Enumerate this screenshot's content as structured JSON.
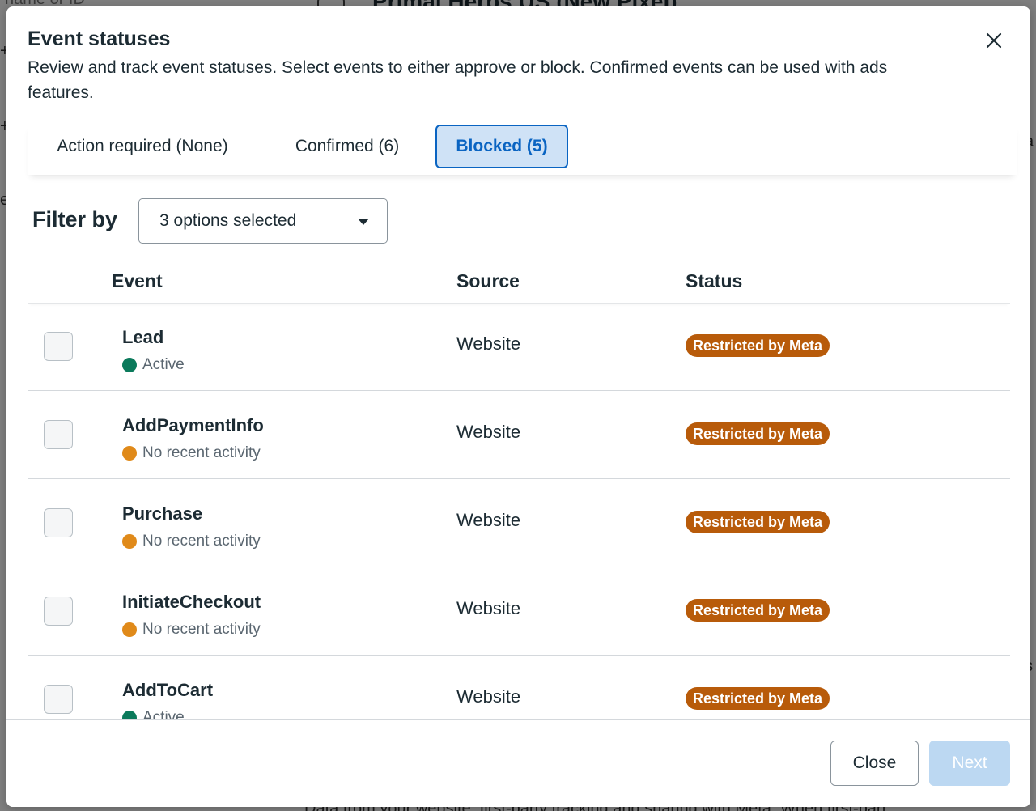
{
  "background": {
    "search_fragment": "name or ID",
    "page_title_fragment": "Primal Herbs US (New Pixel)",
    "bottom_text_fragment": "Data from your website, first-party tracking and sharing with Meta. When first-part"
  },
  "modal": {
    "title": "Event statuses",
    "description": "Review and track event statuses. Select events to either approve or block. Confirmed events can be used with ads features.",
    "close_icon": "close-icon"
  },
  "tabs": [
    {
      "label": "Action required (None)",
      "active": false
    },
    {
      "label": "Confirmed (6)",
      "active": false
    },
    {
      "label": "Blocked (5)",
      "active": true
    }
  ],
  "filter": {
    "label": "Filter by",
    "value": "3 options selected"
  },
  "table": {
    "headers": {
      "event": "Event",
      "source": "Source",
      "status": "Status"
    },
    "rows": [
      {
        "name": "Lead",
        "activity": "Active",
        "activity_color": "#0b7a5b",
        "source": "Website",
        "status": "Restricted by Meta"
      },
      {
        "name": "AddPaymentInfo",
        "activity": "No recent activity",
        "activity_color": "#e08a1a",
        "source": "Website",
        "status": "Restricted by Meta"
      },
      {
        "name": "Purchase",
        "activity": "No recent activity",
        "activity_color": "#e08a1a",
        "source": "Website",
        "status": "Restricted by Meta"
      },
      {
        "name": "InitiateCheckout",
        "activity": "No recent activity",
        "activity_color": "#e08a1a",
        "source": "Website",
        "status": "Restricted by Meta"
      },
      {
        "name": "AddToCart",
        "activity": "Active",
        "activity_color": "#0b7a5b",
        "source": "Website",
        "status": "Restricted by Meta"
      }
    ]
  },
  "footer": {
    "close_label": "Close",
    "next_label": "Next"
  },
  "colors": {
    "accent": "#0a64c2",
    "tab_active_bg": "#cfe2f6",
    "badge": "#b85b0a",
    "next_disabled": "#bcd8f2"
  }
}
